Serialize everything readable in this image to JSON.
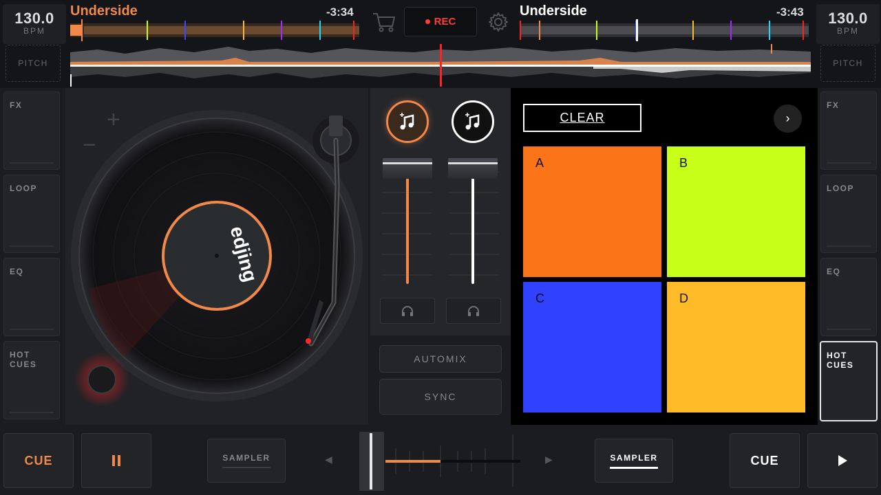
{
  "colors": {
    "left_accent": "#f0894a",
    "right_accent": "#ffffff",
    "rec": "#ff3b3b",
    "pad_a": "#fb7417",
    "pad_b": "#c8ff19",
    "pad_c": "#3041ff",
    "pad_d": "#ffbb27"
  },
  "deck_left": {
    "bpm": "130.0",
    "bpm_label": "BPM",
    "pitch_label": "PITCH",
    "title": "Underside",
    "time": "-3:34",
    "fx": "FX",
    "loop": "LOOP",
    "eq": "EQ",
    "hot_cues": [
      "HOT",
      "CUES"
    ],
    "cue": "CUE",
    "play_icon": "pause-icon",
    "sampler": "SAMPLER",
    "record_label": "edjing"
  },
  "deck_right": {
    "bpm": "130.0",
    "bpm_label": "BPM",
    "pitch_label": "PITCH",
    "title": "Underside",
    "time": "-3:43",
    "fx": "FX",
    "loop": "LOOP",
    "eq": "EQ",
    "hot_cues": [
      "HOT",
      "CUES"
    ],
    "cue": "CUE",
    "play_icon": "play-icon",
    "sampler": "SAMPLER"
  },
  "center": {
    "rec_label": "REC",
    "cart_icon": "shopping-cart-icon",
    "settings_icon": "gear-icon"
  },
  "mixer": {
    "automix": "AUTOMIX",
    "sync": "SYNC",
    "left_volume": 0.9,
    "right_volume": 0.9,
    "crossfader": 0.0
  },
  "sampler_panel": {
    "clear": "CLEAR",
    "next": "›",
    "pads": [
      "A",
      "B",
      "C",
      "D"
    ]
  }
}
